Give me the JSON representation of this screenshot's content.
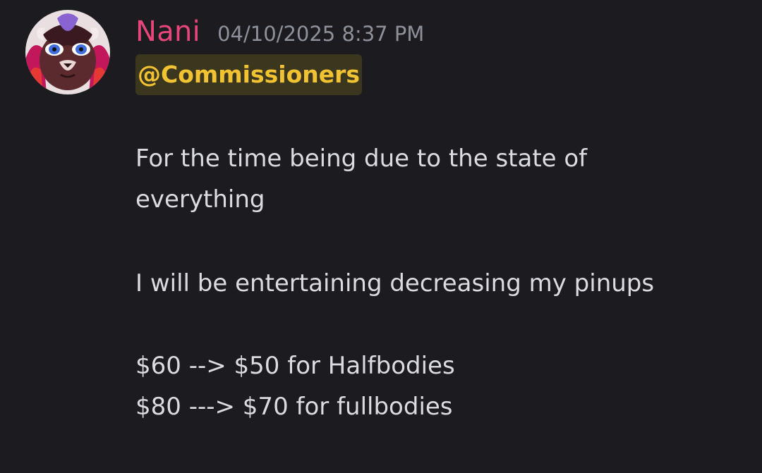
{
  "message": {
    "author": "Nani",
    "timestamp": "04/10/2025 8:37 PM",
    "mention": "@Commissioners",
    "lines": [
      "For the time being due to the state of",
      "everything",
      "I will be entertaining decreasing my pinups",
      "$60 --> $50 for Halfbodies",
      "$80 ---> $70 for fullbodies"
    ]
  },
  "colors": {
    "background": "#1b1b20",
    "author": "#e8457a",
    "timestamp": "#8e9199",
    "mention_text": "#f1c232",
    "mention_bg": "#3b371f",
    "body_text": "#dadce2"
  },
  "icons": {
    "avatar": "avatar-image"
  }
}
